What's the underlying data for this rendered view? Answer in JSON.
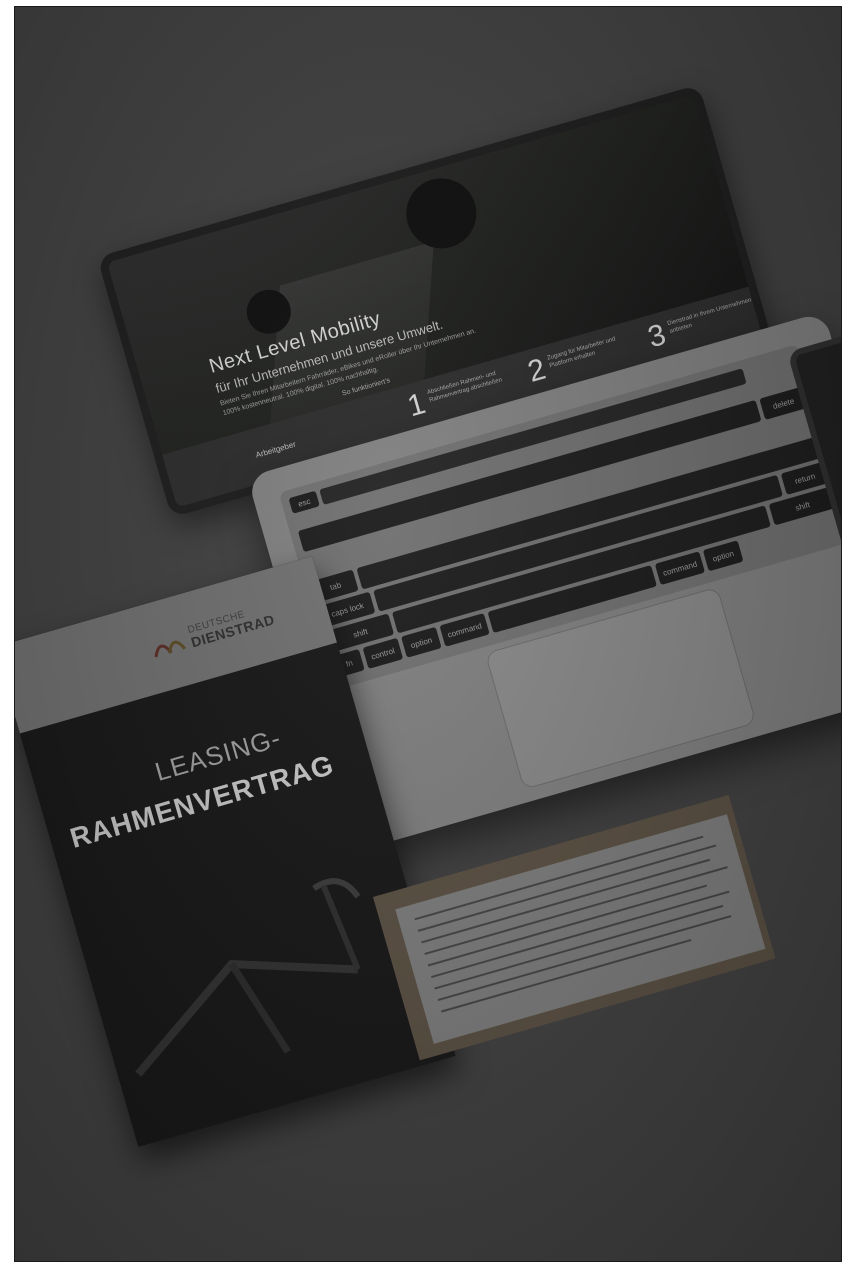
{
  "screen": {
    "title": "Next Level Mobility",
    "subtitle": "für Ihr Unternehmen und unsere Umwelt.",
    "small_1": "Bieten Sie Ihren Mitarbeitern Fahrräder, eBikes und eRoller über Ihr Unternehmen an.",
    "small_2": "100% kostenneutral. 100% digital. 100% nachhaltig.",
    "link": "So funktioniert's",
    "button": "Arbeitgeber",
    "steps": [
      {
        "num": "1",
        "text": "Abschließen Rahmen- und Rahmenvertrag abschließen"
      },
      {
        "num": "2",
        "text": "Zugang für Mitarbeiter und Plattform erhalten"
      },
      {
        "num": "3",
        "text": "Dienstrad in Ihrem Unternehmen anbieten"
      }
    ]
  },
  "keyboard": {
    "keys": [
      "esc",
      "tab",
      "caps lock",
      "shift",
      "fn",
      "control",
      "option",
      "command",
      "delete",
      "return",
      "shift",
      "option",
      "command"
    ]
  },
  "folder": {
    "logo_top": "DEUTSCHE",
    "logo_main": "DIENSTRAD",
    "title_line1": "LEASING-",
    "title_line2": "RAHMENVERTRAG"
  }
}
